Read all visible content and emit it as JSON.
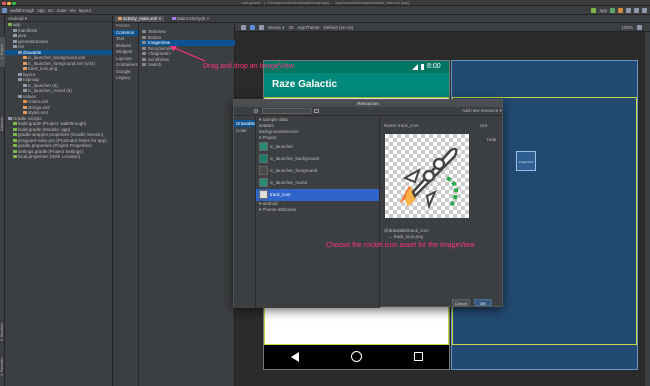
{
  "titlebar": {
    "title": "raze-galactic - [~/Development/android/walkthrough/app] - .../app/src/main/res/layout/activity_main.xml [app]"
  },
  "toolbar": {
    "crumbs": [
      "walkthrough",
      "app",
      "src",
      "main",
      "res",
      "layout"
    ],
    "run_config": "app"
  },
  "project_panel": {
    "header": "Android",
    "tree": [
      {
        "label": "app",
        "indent": 0,
        "icon_color": "#7eb74a"
      },
      {
        "label": "manifests",
        "indent": 1,
        "icon_color": "#8f9bad"
      },
      {
        "label": "java",
        "indent": 1,
        "icon_color": "#8f9bad"
      },
      {
        "label": "generatedJava",
        "indent": 1,
        "icon_color": "#8f9bad"
      },
      {
        "label": "res",
        "indent": 1,
        "icon_color": "#8f9bad"
      },
      {
        "label": "drawable",
        "indent": 2,
        "icon_color": "#8f9bad",
        "selected": true
      },
      {
        "label": "ic_launcher_background.xml",
        "indent": 3,
        "icon_color": "#e59a5c"
      },
      {
        "label": "ic_launcher_foreground.xml (v24)",
        "indent": 3,
        "icon_color": "#e59a5c"
      },
      {
        "label": "track_icon.png",
        "indent": 3,
        "icon_color": "#e59a5c"
      },
      {
        "label": "layout",
        "indent": 2,
        "icon_color": "#8f9bad"
      },
      {
        "label": "mipmap",
        "indent": 2,
        "icon_color": "#8f9bad"
      },
      {
        "label": "ic_launcher (6)",
        "indent": 3,
        "icon_color": "#8f9bad"
      },
      {
        "label": "ic_launcher_round (6)",
        "indent": 3,
        "icon_color": "#8f9bad"
      },
      {
        "label": "values",
        "indent": 2,
        "icon_color": "#8f9bad"
      },
      {
        "label": "colors.xml",
        "indent": 3,
        "icon_color": "#e59a5c"
      },
      {
        "label": "strings.xml",
        "indent": 3,
        "icon_color": "#e59a5c"
      },
      {
        "label": "styles.xml",
        "indent": 3,
        "icon_color": "#e59a5c"
      },
      {
        "label": "Gradle Scripts",
        "indent": 0,
        "icon_color": "#8f9bad"
      },
      {
        "label": "build.gradle (Project: walkthrough)",
        "indent": 1,
        "icon_color": "#7eb74a"
      },
      {
        "label": "build.gradle (Module: app)",
        "indent": 1,
        "icon_color": "#7eb74a"
      },
      {
        "label": "gradle-wrapper.properties (Gradle Version)",
        "indent": 1,
        "icon_color": "#7eb74a"
      },
      {
        "label": "proguard-rules.pro (ProGuard Rules for app)",
        "indent": 1,
        "icon_color": "#7eb74a"
      },
      {
        "label": "gradle.properties (Project Properties)",
        "indent": 1,
        "icon_color": "#7eb74a"
      },
      {
        "label": "settings.gradle (Project Settings)",
        "indent": 1,
        "icon_color": "#7eb74a"
      },
      {
        "label": "local.properties (SDK Location)",
        "indent": 1,
        "icon_color": "#7eb74a"
      }
    ]
  },
  "editor_tabs": [
    "activity_main.xml",
    "MainActivity.kt"
  ],
  "palette": {
    "header": "Palette",
    "categories": [
      "Common",
      "Text",
      "Buttons",
      "Widgets",
      "Layouts",
      "Containers",
      "Google",
      "Legacy"
    ],
    "selected_category": "Common",
    "items": [
      {
        "label": "TextView"
      },
      {
        "label": "Button"
      },
      {
        "label": "ImageView",
        "selected": true
      },
      {
        "label": "RecyclerView"
      },
      {
        "label": "<fragment>"
      },
      {
        "label": "ScrollView"
      },
      {
        "label": "Switch"
      }
    ]
  },
  "design_toolbar": {
    "device": "Nexus 4",
    "api": "28",
    "theme": "AppTheme",
    "locale": "Default (en-us)",
    "zoom": "100%"
  },
  "phone": {
    "time": "8:00",
    "app_title": "Raze Galactic"
  },
  "blueprint": {
    "widget_label": "imageView"
  },
  "annotations": {
    "drag_note": "Drag and drop an ImageView",
    "choose_note": "Choose the rocket icon asset for the ImageView"
  },
  "dialog": {
    "title": "Resources",
    "search_placeholder": "",
    "add_new": "Add new resource ▾",
    "left_categories": [
      "Drawable",
      "Color"
    ],
    "selected_left": "Drawable",
    "list": [
      {
        "label": "Sample data",
        "kind": "header"
      },
      {
        "label": "avatars",
        "kind": "row"
      },
      {
        "label": "backgrounds/scenic",
        "kind": "row"
      },
      {
        "label": "Project",
        "kind": "header"
      },
      {
        "label": "ic_launcher",
        "kind": "big",
        "thumb": "#2a8a78"
      },
      {
        "label": "ic_launcher_background",
        "kind": "big",
        "thumb": "#1e7d6d"
      },
      {
        "label": "ic_launcher_foreground",
        "kind": "big",
        "thumb": "#4a4a4a"
      },
      {
        "label": "ic_launcher_round",
        "kind": "big",
        "thumb": "#2a8a78"
      },
      {
        "label": "track_icon",
        "kind": "big",
        "thumb": "#dddddd",
        "selected": true
      },
      {
        "label": "android",
        "kind": "header"
      },
      {
        "label": "Theme attributes",
        "kind": "header"
      }
    ],
    "name_label": "Name:",
    "name_value": "track_icon",
    "density": "v24",
    "help": "Help",
    "resource_ref": "@drawable/track_icon",
    "file_ref": "→ track_icon.png",
    "cancel": "Cancel",
    "ok": "OK"
  },
  "side_labels": {
    "project": "1: Project",
    "captures": "Captures",
    "structure": "2: Structure",
    "build_variants": "Build Variants",
    "favorites": "2: Favorites",
    "component_tree": "Component Tree"
  }
}
